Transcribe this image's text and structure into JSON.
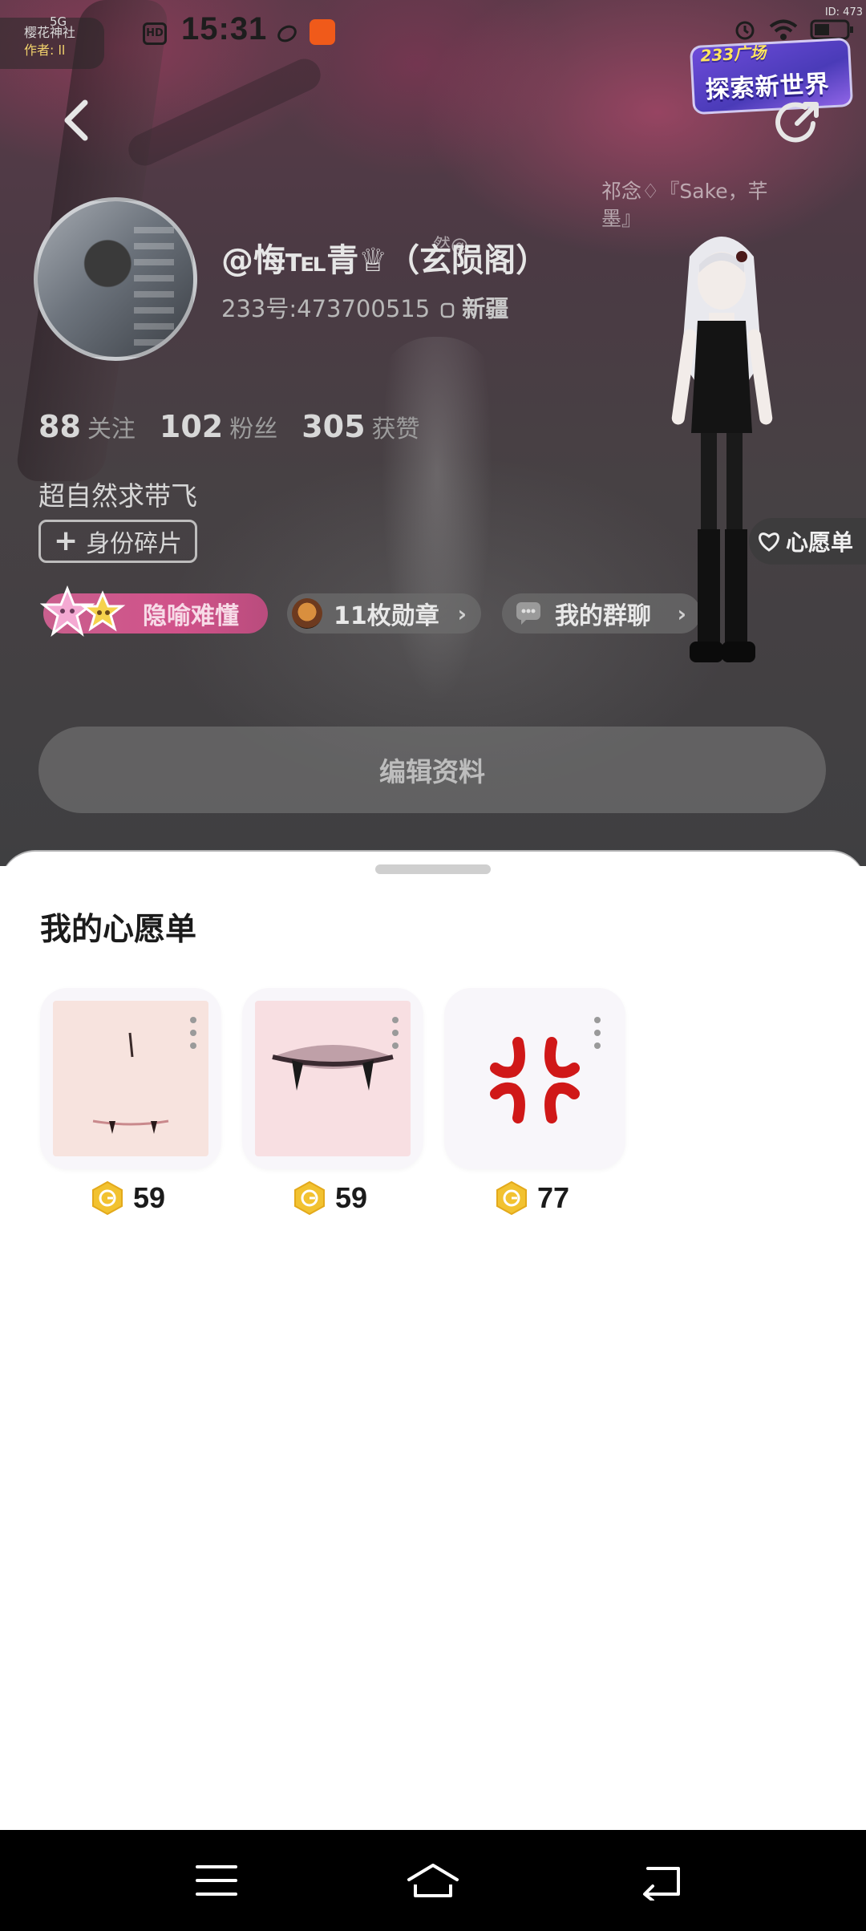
{
  "status_bar": {
    "time": "15:31",
    "network": "5G",
    "hd": "HD",
    "id_corner": "ID: 473",
    "mini_badge_line1": "樱花神社",
    "mini_badge_line2": "作者: ll"
  },
  "promo": {
    "top": "233广场",
    "bottom": "探索新世界"
  },
  "floating_note": "祁念♢『Sake，芊墨』",
  "floating_note_small": "然@",
  "profile": {
    "username": "@悔℡青♕（玄陨阁）",
    "user_id": "233号:473700515",
    "region": "新疆",
    "bio": "超自然求带飞",
    "identity_button": "身份碎片",
    "wishlist_tag": "心愿单"
  },
  "stats": [
    {
      "value": "88",
      "label": "关注"
    },
    {
      "value": "102",
      "label": "粉丝"
    },
    {
      "value": "305",
      "label": "获赞"
    }
  ],
  "chips": {
    "title": "隐喻难懂",
    "medals": "11枚勋章",
    "group": "我的群聊"
  },
  "edit_button": "编辑资料",
  "sheet": {
    "title": "我的心愿单",
    "items": [
      {
        "name": "fang-smile-face",
        "price": "59"
      },
      {
        "name": "vampire-lips",
        "price": "59"
      },
      {
        "name": "anger-mark",
        "price": "77"
      }
    ]
  },
  "colors": {
    "accent_pink": "#d1528a",
    "coin_gold": "#f2c230",
    "anger_red": "#d01818"
  }
}
